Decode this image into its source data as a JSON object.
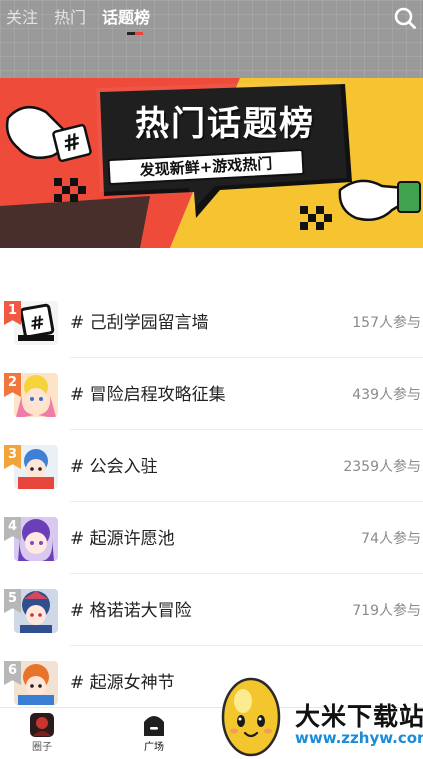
{
  "header": {
    "tabs": [
      {
        "label": "关注",
        "active": false
      },
      {
        "label": "热门",
        "active": false
      },
      {
        "label": "话题榜",
        "active": true
      }
    ],
    "search_icon": "search-icon",
    "indicator_colors": [
      "#222222",
      "#e8453c"
    ]
  },
  "banner": {
    "title": "热门话题榜",
    "subtitle": "发现新鲜+游戏热门",
    "colors": {
      "left": "#ee4b3b",
      "right": "#f7c431",
      "ink": "#111111"
    }
  },
  "topics": [
    {
      "rank": "1",
      "name": "# 己刮学园留言墙",
      "count": "157人参与",
      "badge_color": "#f05a44"
    },
    {
      "rank": "2",
      "name": "# 冒险启程攻略征集",
      "count": "439人参与",
      "badge_color": "#f0763d"
    },
    {
      "rank": "3",
      "name": "# 公会入驻",
      "count": "2359人参与",
      "badge_color": "#f2a33a"
    },
    {
      "rank": "4",
      "name": "# 起源许愿池",
      "count": "74人参与",
      "badge_color": "#b7b7b7"
    },
    {
      "rank": "5",
      "name": "# 格诺诺大冒险",
      "count": "719人参与",
      "badge_color": "#b7b7b7"
    },
    {
      "rank": "6",
      "name": "# 起源女神节",
      "count": "",
      "badge_color": "#b7b7b7"
    }
  ],
  "bottom_nav": [
    {
      "label": "圈子",
      "icon": "circle-avatar-icon"
    },
    {
      "label": "广场",
      "icon": "plaza-icon"
    }
  ],
  "watermark": {
    "title": "大米下载站",
    "url": "www.zzhyw.com"
  }
}
